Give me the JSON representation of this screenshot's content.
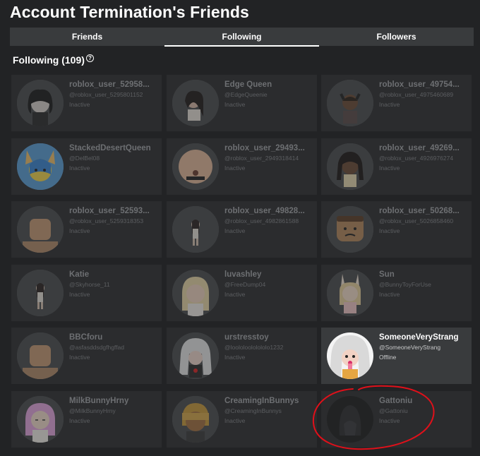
{
  "page": {
    "title": "Account Termination's Friends"
  },
  "tabs": [
    {
      "label": "Friends",
      "active": false
    },
    {
      "label": "Following",
      "active": true
    },
    {
      "label": "Followers",
      "active": false
    }
  ],
  "section": {
    "title": "Following (109)",
    "help_glyph": "?"
  },
  "cards": [
    {
      "name": "roblox_user_52958...",
      "handle": "@roblox_user_5295801152",
      "status": "Inactive",
      "avatar": "blk-hair",
      "highlight": false
    },
    {
      "name": "Edge Queen",
      "handle": "@EdgeQueenie",
      "status": "Inactive",
      "avatar": "dark-hair",
      "highlight": false
    },
    {
      "name": "roblox_user_49754...",
      "handle": "@roblox_user_4975460689",
      "status": "Inactive",
      "avatar": "horns",
      "highlight": false
    },
    {
      "name": "StackedDesertQueen",
      "handle": "@DelBel08",
      "status": "Inactive",
      "avatar": "blue-cat",
      "highlight": false
    },
    {
      "name": "roblox_user_29493...",
      "handle": "@roblox_user_2949318414",
      "status": "Inactive",
      "avatar": "skin-face",
      "highlight": false
    },
    {
      "name": "roblox_user_49269...",
      "handle": "@roblox_user_4926976274",
      "status": "Inactive",
      "avatar": "braids",
      "highlight": false
    },
    {
      "name": "roblox_user_52593...",
      "handle": "@roblox_user_5259318353",
      "status": "Inactive",
      "avatar": "classic-head",
      "highlight": false
    },
    {
      "name": "roblox_user_49828...",
      "handle": "@roblox_user_4982861588",
      "status": "Inactive",
      "avatar": "small-figure",
      "highlight": false
    },
    {
      "name": "roblox_user_50268...",
      "handle": "@roblox_user_5026858460",
      "status": "Inactive",
      "avatar": "brown-head",
      "highlight": false
    },
    {
      "name": "Katie",
      "handle": "@Skyhorse_11",
      "status": "Inactive",
      "avatar": "small-figure",
      "highlight": false
    },
    {
      "name": "luvashley",
      "handle": "@FreeDump04",
      "status": "Inactive",
      "avatar": "blonde",
      "highlight": false
    },
    {
      "name": "Sun",
      "handle": "@BunnyToyForUse",
      "status": "Inactive",
      "avatar": "bunny",
      "highlight": false
    },
    {
      "name": "BBCforu",
      "handle": "@asfasddsdgfhgffad",
      "status": "Inactive",
      "avatar": "classic-head",
      "highlight": false
    },
    {
      "name": "urstresstoy",
      "handle": "@loololoololololo1232",
      "status": "Inactive",
      "avatar": "white-hair",
      "highlight": false
    },
    {
      "name": "SomeoneVeryStrang",
      "handle": "@SomeoneVeryStrang",
      "status": "Offline",
      "avatar": "white-hair-big",
      "highlight": true
    },
    {
      "name": "MilkBunnyHrny",
      "handle": "@MilkBunnyHrny",
      "status": "Inactive",
      "avatar": "pink-hair",
      "highlight": false
    },
    {
      "name": "CreamingInBunnys",
      "handle": "@CreamingInBunnys",
      "status": "Inactive",
      "avatar": "blonde-boy",
      "highlight": false
    },
    {
      "name": "Gattoniu",
      "handle": "@Gattoniu",
      "status": "Inactive",
      "avatar": "dark-sil",
      "highlight": false
    }
  ],
  "colors": {
    "background": "#222325",
    "card": "#2b2c2e",
    "card_highlight": "#393b3d",
    "annotation": "#e0101a"
  }
}
